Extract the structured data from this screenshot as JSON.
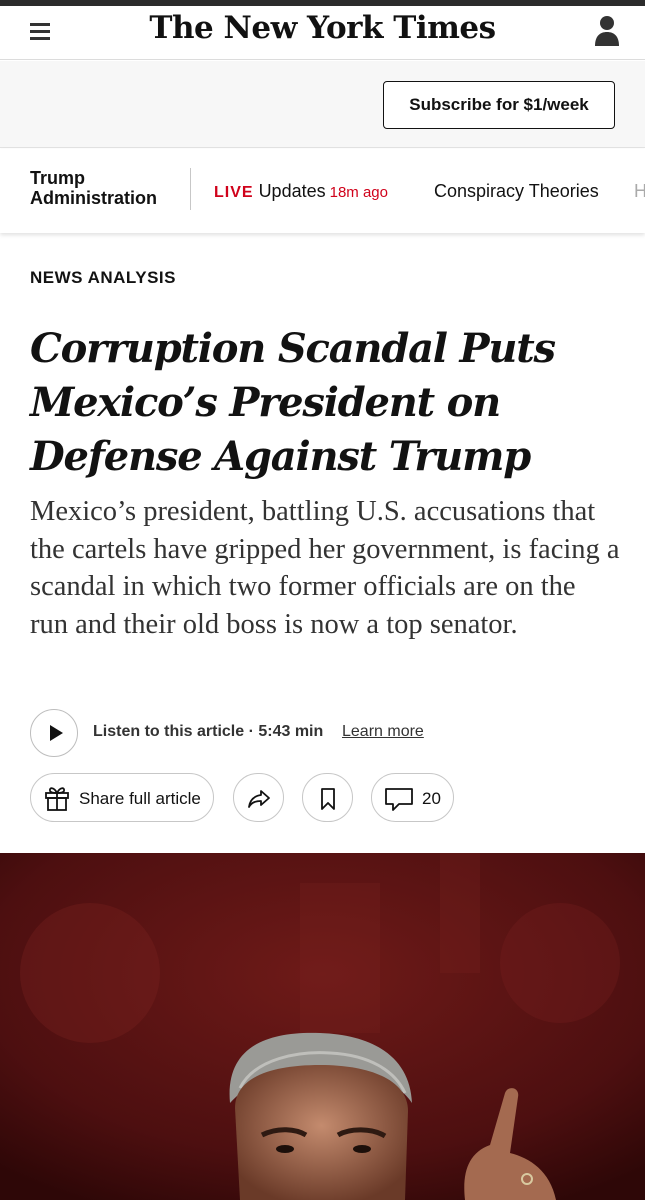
{
  "masthead": {
    "logo_text": "The New York Times",
    "menu_icon": "hamburger-menu-icon",
    "account_icon": "user-account-icon"
  },
  "subscribe": {
    "button_label": "Subscribe for $1/week"
  },
  "section_nav": {
    "section_title_line1": "Trump",
    "section_title_line2": "Administration",
    "live": {
      "tag": "LIVE",
      "label": "Updates",
      "time": "18m ago"
    },
    "links": [
      "Conspiracy Theories",
      "H"
    ]
  },
  "article": {
    "kicker": "NEWS ANALYSIS",
    "headline": "Corruption Scandal Puts Mexico’s President on Defense Against Trump",
    "summary": "Mexico’s president, battling U.S. accusations that the cartels have gripped her government, is facing a scandal in which two former officials are on the run and their old boss is now a top senator."
  },
  "audio": {
    "play_icon": "play-icon",
    "listen_label": "Listen to this article · 5:43 min",
    "learn_more": "Learn more"
  },
  "actions": {
    "share_label": "Share full article",
    "gift_icon": "gift-icon",
    "forward_icon": "share-arrow-icon",
    "bookmark_icon": "bookmark-icon",
    "comment_icon": "comment-icon",
    "comment_count": "20"
  },
  "colors": {
    "live_red": "#d0021b",
    "text": "#121212",
    "photo_background": "#5e1413"
  }
}
